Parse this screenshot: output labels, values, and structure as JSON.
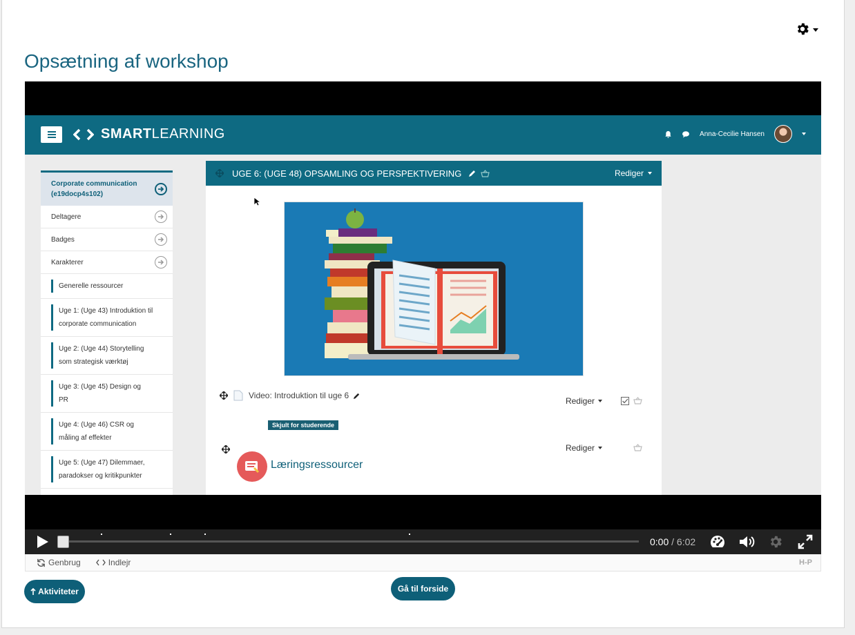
{
  "page": {
    "title": "Opsætning af workshop"
  },
  "video_frame": {
    "header": {
      "brand_bold": "SMART",
      "brand_light": "LEARNING",
      "user": "Anna-Cecilie Hansen"
    },
    "sidebar": {
      "course": "Corporate communication (e19docp4s102)",
      "items": [
        "Deltagere",
        "Badges",
        "Karakterer"
      ],
      "sections": [
        "Generelle ressourcer",
        "Uge 1: (Uge 43) Introduktion til corporate communication",
        "Uge 2: (Uge 44) Storytelling som strategisk værktøj",
        "Uge 3: (Uge 45) Design og PR",
        "Uge 4: (Uge 46) CSR og måling af effekter",
        "Uge 5: (Uge 47) Dilemmaer, paradokser og kritikpunkter"
      ]
    },
    "main": {
      "section_title": "UGE 6: (UGE 48) OPSAMLING OG PERSPEKTIVERING",
      "edit_label": "Rediger",
      "video_item": "Video: Introduktion til uge 6",
      "hidden_badge": "Skjult for studerende",
      "resources_title": "Læringsressourcer"
    }
  },
  "player": {
    "current_time": "0:00",
    "separator": " / ",
    "duration": "6:02",
    "progress": 0
  },
  "h5p": {
    "reuse": "Genbrug",
    "embed": "Indlejr",
    "logo": "H-P"
  },
  "buttons": {
    "activities": "Aktiviteter",
    "home": "Gå til forside"
  },
  "colors": {
    "accent": "#0e6a82",
    "title": "#1a6580"
  }
}
